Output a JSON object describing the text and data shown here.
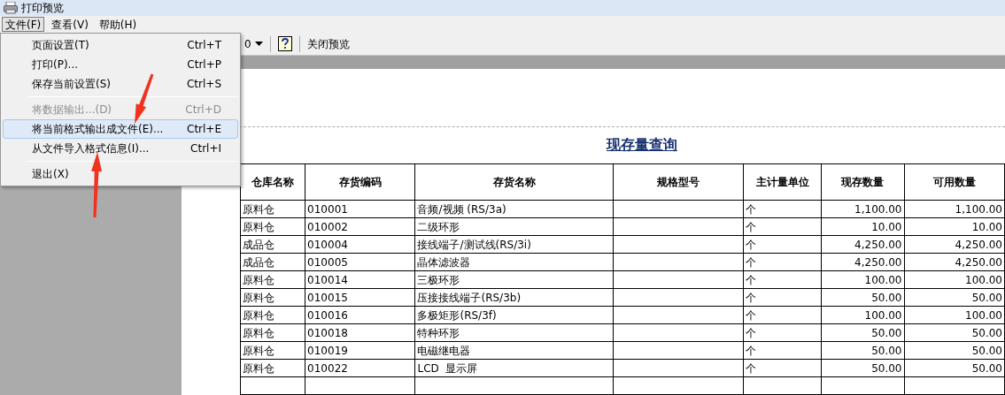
{
  "window": {
    "title": "打印预览"
  },
  "menu_bar": [
    {
      "label": "文件(F)",
      "selected": true
    },
    {
      "label": "查看(V)",
      "selected": false
    },
    {
      "label": "帮助(H)",
      "selected": false
    }
  ],
  "toolbar": {
    "zoom_value": "0",
    "close_label": "关闭预览"
  },
  "file_menu": [
    {
      "kind": "item",
      "label": "页面设置(T)",
      "shortcut": "Ctrl+T",
      "disabled": false,
      "selected": false
    },
    {
      "kind": "item",
      "label": "打印(P)...",
      "shortcut": "Ctrl+P",
      "disabled": false,
      "selected": false
    },
    {
      "kind": "item",
      "label": "保存当前设置(S)",
      "shortcut": "Ctrl+S",
      "disabled": false,
      "selected": false
    },
    {
      "kind": "separator"
    },
    {
      "kind": "item",
      "label": "将数据输出...(D)",
      "shortcut": "Ctrl+D",
      "disabled": true,
      "selected": false
    },
    {
      "kind": "item",
      "label": "将当前格式输出成文件(E)...",
      "shortcut": "Ctrl+E",
      "disabled": false,
      "selected": true
    },
    {
      "kind": "item",
      "label": "从文件导入格式信息(I)...",
      "shortcut": "Ctrl+I",
      "disabled": false,
      "selected": false
    },
    {
      "kind": "separator"
    },
    {
      "kind": "item",
      "label": "退出(X)",
      "disabled": false,
      "selected": false
    }
  ],
  "report": {
    "title": "现存量查询",
    "columns": [
      "仓库名称",
      "存货编码",
      "存货名称",
      "规格型号",
      "主计量单位",
      "现存数量",
      "可用数量"
    ],
    "rows": [
      [
        "原料仓",
        "010001",
        "音频/视频 (RS/3a)",
        "",
        "个",
        "1,100.00",
        "1,100.00"
      ],
      [
        "原料仓",
        "010002",
        "二级环形",
        "",
        "个",
        "10.00",
        "10.00"
      ],
      [
        "成品仓",
        "010004",
        "接线端子/测试线(RS/3i)",
        "",
        "个",
        "4,250.00",
        "4,250.00"
      ],
      [
        "成品仓",
        "010005",
        "晶体滤波器",
        "",
        "个",
        "4,250.00",
        "4,250.00"
      ],
      [
        "原料仓",
        "010014",
        "三极环形",
        "",
        "个",
        "100.00",
        "100.00"
      ],
      [
        "原料仓",
        "010015",
        "压接接线端子(RS/3b)",
        "",
        "个",
        "50.00",
        "50.00"
      ],
      [
        "原料仓",
        "010016",
        "多极矩形(RS/3f)",
        "",
        "个",
        "100.00",
        "100.00"
      ],
      [
        "原料仓",
        "010018",
        "特种环形",
        "",
        "个",
        "50.00",
        "50.00"
      ],
      [
        "原料仓",
        "010019",
        "电磁继电器",
        "",
        "个",
        "50.00",
        "50.00"
      ],
      [
        "原料仓",
        "010022",
        "LCD  显示屏",
        "",
        "个",
        "50.00",
        "50.00"
      ]
    ]
  }
}
